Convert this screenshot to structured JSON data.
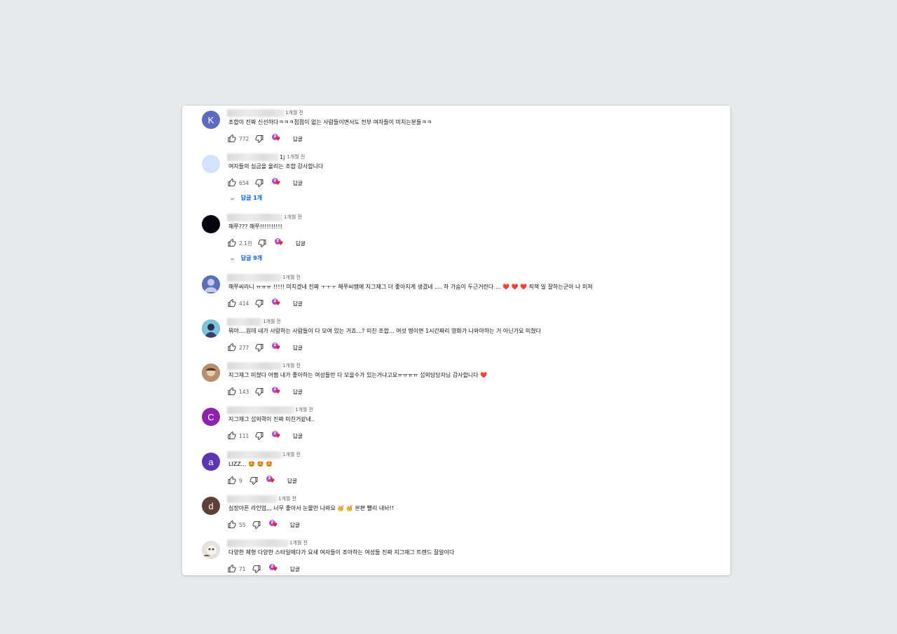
{
  "comments": [
    {
      "avatar_letter": "K",
      "avatar_color": "#5c6bc0",
      "name_tail": "",
      "time": "1개월 전",
      "text": "조합이 진짜 신선하다ㅋㅋㅋ접점이 없는 사람들이면서도 전부 여자들이 미치는분들ㅋㅋ",
      "likes": "772",
      "reply": "답글",
      "creator_badge": "Z",
      "replies": ""
    },
    {
      "avatar_letter": "",
      "avatar_color": "#d3e3fd",
      "name_tail": "1j",
      "time": "1개월 전",
      "text": "여자들의 심금을 울리는 조합 감사합니다",
      "likes": "654",
      "reply": "답글",
      "creator_badge": "Z",
      "replies": "답글 1개"
    },
    {
      "avatar_letter": "",
      "avatar_color": "#050510",
      "name_tail": "",
      "time": "1개월 전",
      "text": "해쭈??? 해쭈!!!!!!!!!!",
      "likes": "2.1천",
      "reply": "답글",
      "creator_badge": "Z",
      "replies": "답글 9개"
    },
    {
      "avatar_letter": "",
      "avatar_color": "#5b6eb8",
      "name_tail": "",
      "time": "1개월 전",
      "text": "해쭈씨라니 ㅠㅠㅠ !!!!! 미치겠네 진짜 ㅜㅜㅜ 해쭈씨땜에 지그재그 더 좋아지게 생겼네 .... 하 가슴이 두근거린다 ...",
      "text_after": "직책 일 잘하는군아 나 미쳐",
      "likes": "414",
      "reply": "답글",
      "creator_badge": "Z",
      "replies": ""
    },
    {
      "avatar_letter": "",
      "avatar_color": "#4aa9c9",
      "name_tail": "",
      "time": "1개월 전",
      "text": "뭐야....원데 내가 사랑하는 사람들이 다 모여 있는 거죠...? 미친 조합... 여섯 명이면 1시간짜리 영화가 나와야하는 거 아닌가요 미쳤다",
      "likes": "277",
      "reply": "답글",
      "creator_badge": "Z",
      "replies": ""
    },
    {
      "avatar_letter": "",
      "avatar_color": "#a0785a",
      "name_tail": "",
      "time": "1개월 전",
      "text": "지그재그 미쳤다 어쩜 내가 좋아하는 여성들만 다 모을수가 있는거냐고요ㅠㅠㅠㅠ 섭외담당자님 감사합니다",
      "likes": "143",
      "reply": "답글",
      "creator_badge": "Z",
      "replies": ""
    },
    {
      "avatar_letter": "C",
      "avatar_color": "#8e24aa",
      "name_tail": "",
      "time": "1개월 전",
      "text": "지그재그 섭외력이 진짜 미친거같네..",
      "likes": "111",
      "reply": "답글",
      "creator_badge": "Z",
      "replies": ""
    },
    {
      "avatar_letter": "a",
      "avatar_color": "#5e35b1",
      "name_tail": "",
      "time": "1개월 전",
      "text": "LIZZ...",
      "emoji_after": "🤩 🤩 🤩",
      "likes": "9",
      "reply": "답글",
      "creator_badge": "Z",
      "replies": ""
    },
    {
      "avatar_letter": "d",
      "avatar_color": "#5d4037",
      "name_tail": "",
      "time": "1개월 전",
      "text": "심장아픈 라인업,,, 너무 좋아서 눈물만 나와요",
      "emoji_after": "🥳 🥳",
      "text_after": "본편 빨리 내놔!!",
      "likes": "55",
      "reply": "답글",
      "creator_badge": "Z",
      "replies": ""
    },
    {
      "avatar_letter": "",
      "avatar_color": "#cfc8c0",
      "name_tail": "",
      "time": "1개월 전",
      "text": "다양한 체형 다양한 스타일에다가 요새 여자들이 조아하는 여성들 진짜 지그재그 트렌드 잘알이다",
      "likes": "71",
      "reply": "답글",
      "creator_badge": "Z",
      "replies": ""
    }
  ]
}
